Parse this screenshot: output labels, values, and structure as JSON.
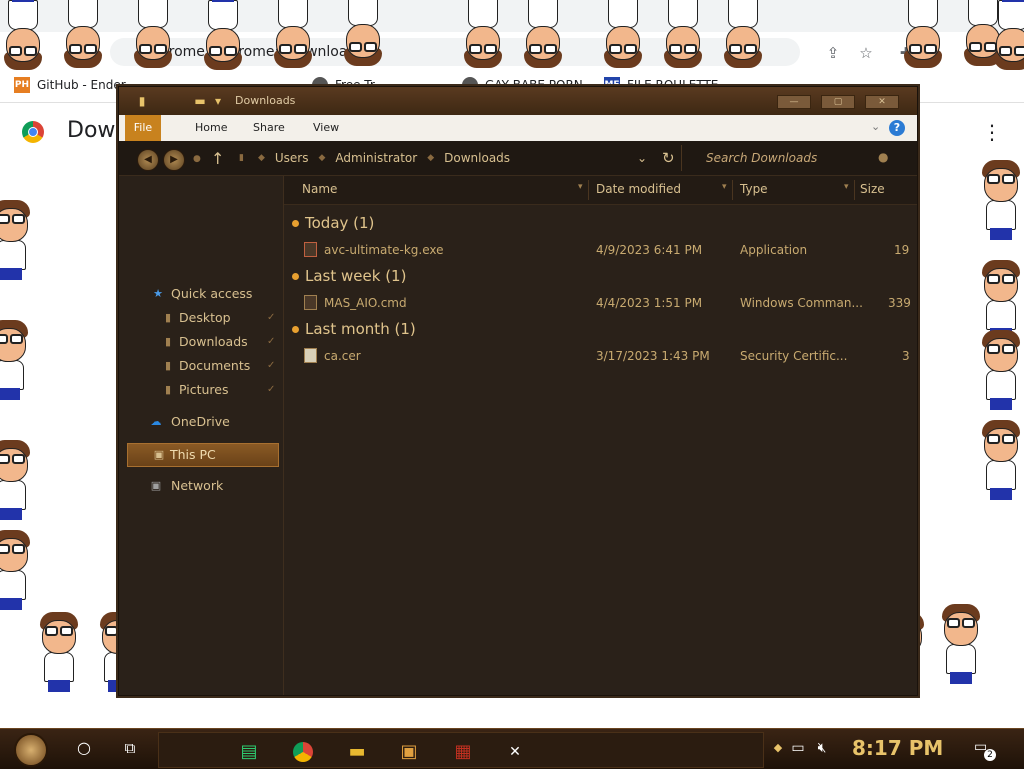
{
  "browser": {
    "url_host": "Chrome",
    "url_path": "chrome://downloads",
    "page_title": "Downloads",
    "bookmarks": [
      {
        "label": "GitHub - Ender...",
        "icon": "ph-icon",
        "badge": "PH",
        "color": "#e67e22"
      },
      {
        "label": "Free Tr...",
        "icon": "globe-icon",
        "badge": "",
        "color": "#555555"
      },
      {
        "label": "GAY BABE PORN...",
        "icon": "globe-icon",
        "badge": "",
        "color": "#555555"
      },
      {
        "label": "FILE ROULETTE",
        "icon": "mf-icon",
        "badge": "MF",
        "color": "#2244aa"
      }
    ]
  },
  "explorer": {
    "title": "Downloads",
    "ribbon_tabs": [
      "File",
      "Home",
      "Share",
      "View"
    ],
    "breadcrumb": [
      "Users",
      "Administrator",
      "Downloads"
    ],
    "search_placeholder": "Search Downloads",
    "nav": {
      "quick_access": "Quick access",
      "desktop": "Desktop",
      "downloads": "Downloads",
      "documents": "Documents",
      "pictures": "Pictures",
      "onedrive": "OneDrive",
      "thispc": "This PC",
      "network": "Network"
    },
    "columns": {
      "name": "Name",
      "date": "Date modified",
      "type": "Type",
      "size": "Size"
    },
    "groups": [
      {
        "label": "Today (1)",
        "files": [
          {
            "name": "avc-ultimate-kg.exe",
            "date": "4/9/2023 6:41 PM",
            "type": "Application",
            "size": "19"
          }
        ]
      },
      {
        "label": "Last week (1)",
        "files": [
          {
            "name": "MAS_AIO.cmd",
            "date": "4/4/2023 1:51 PM",
            "type": "Windows Comman...",
            "size": "339"
          }
        ]
      },
      {
        "label": "Last month (1)",
        "files": [
          {
            "name": "ca.cer",
            "date": "3/17/2023 1:43 PM",
            "type": "Security Certific...",
            "size": "3"
          }
        ]
      }
    ]
  },
  "taskbar": {
    "clock": "8:17 PM",
    "notification_count": "2"
  },
  "colors": {
    "accent": "#c8821e",
    "explorer_bg": "#2a2119",
    "text_gold": "#d8c090"
  }
}
